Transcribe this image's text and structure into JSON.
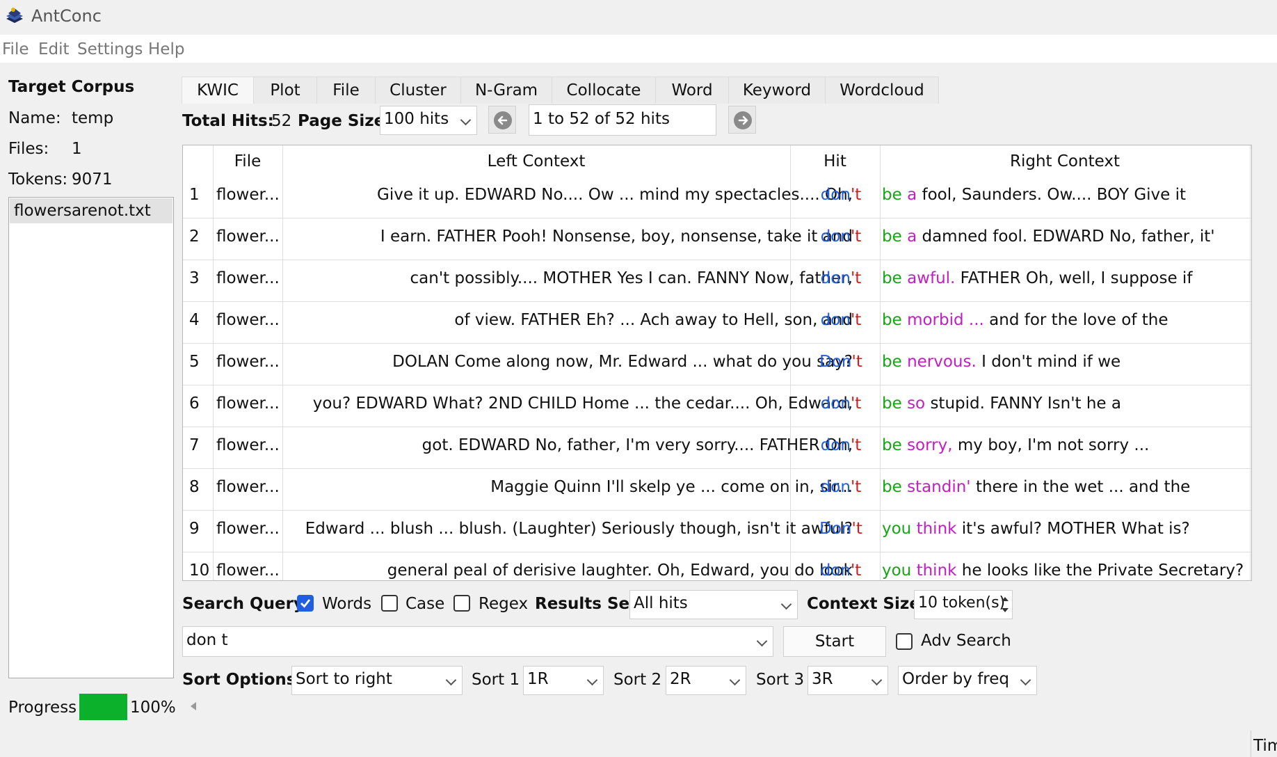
{
  "app": {
    "title": "AntConc"
  },
  "menu": [
    "File",
    "Edit",
    "Settings",
    "Help"
  ],
  "corpus": {
    "heading": "Target Corpus",
    "name_label": "Name:",
    "name_value": "temp",
    "files_label": "Files:",
    "files_value": "1",
    "tokens_label": "Tokens:",
    "tokens_value": "9071",
    "file_list": [
      "flowersarenot.txt"
    ]
  },
  "progress": {
    "label": "Progress",
    "percent_text": "100%",
    "value": 1.0,
    "color": "#0bb02b"
  },
  "tabs": [
    "KWIC",
    "Plot",
    "File",
    "Cluster",
    "N-Gram",
    "Collocate",
    "Word",
    "Keyword",
    "Wordcloud"
  ],
  "active_tab": "KWIC",
  "toolbar": {
    "total_hits_label": "Total Hits:",
    "total_hits_value": "52",
    "page_size_label": "Page Size",
    "page_size_value": "100 hits",
    "range_text": "1 to 52 of 52 hits"
  },
  "table": {
    "headers": [
      "File",
      "Left Context",
      "Hit",
      "Right Context"
    ],
    "rows": [
      {
        "n": "1",
        "file": "flower...",
        "left": "Give it up. EDWARD No.... Ow ... mind my spectacles.... Oh,",
        "hit": "don't",
        "r1": "be",
        "r2": "a",
        "rest": "fool, Saunders. Ow.... BOY Give it"
      },
      {
        "n": "2",
        "file": "flower...",
        "left": "I earn. FATHER Pooh! Nonsense, boy, nonsense, take it and",
        "hit": "don't",
        "r1": "be",
        "r2": "a",
        "rest": "damned fool. EDWARD No, father, it'"
      },
      {
        "n": "3",
        "file": "flower...",
        "left": "can't possibly.... MOTHER Yes I can. FANNY Now, father,",
        "hit": "don't",
        "r1": "be",
        "r2": "awful.",
        "rest": "FATHER Oh, well, I suppose if"
      },
      {
        "n": "4",
        "file": "flower...",
        "left": "of view. FATHER Eh? ... Ach away to Hell, son, and",
        "hit": "don't",
        "r1": "be",
        "r2": "morbid ...",
        "rest": "and for the love of the"
      },
      {
        "n": "5",
        "file": "flower...",
        "left": "DOLAN Come along now, Mr. Edward ... what do you say?",
        "hit": "Don't",
        "r1": "be",
        "r2": "nervous.",
        "rest": "I don't mind if we"
      },
      {
        "n": "6",
        "file": "flower...",
        "left": "you? EDWARD What? 2ND CHILD Home ... the cedar.... Oh, Edward,",
        "hit": "don't",
        "r1": "be",
        "r2": "so",
        "rest": "stupid. FANNY Isn't he a"
      },
      {
        "n": "7",
        "file": "flower...",
        "left": "got. EDWARD No, father, I'm very sorry.... FATHER Oh,",
        "hit": "don't",
        "r1": "be",
        "r2": "sorry,",
        "rest": "my boy, I'm not sorry ..."
      },
      {
        "n": "8",
        "file": "flower...",
        "left": "Maggie Quinn I'll skelp ye ... come on in, sir...",
        "hit": "don't",
        "r1": "be",
        "r2": "standin'",
        "rest": "there in the wet ... and the"
      },
      {
        "n": "9",
        "file": "flower...",
        "left": "Edward ... blush ... blush. (Laughter) Seriously though, isn't it awful?",
        "hit": "Don't",
        "r1": "you",
        "r2": "think",
        "rest": "it's awful? MOTHER What is?"
      },
      {
        "n": "10",
        "file": "flower...",
        "left": "general peal of derisive laughter. Oh, Edward, you do look",
        "hit": "don't",
        "r1": "you",
        "r2": "think",
        "rest": "he looks like the Private Secretary?"
      }
    ]
  },
  "search": {
    "query_label": "Search Query",
    "words_label": "Words",
    "words_checked": true,
    "case_label": "Case",
    "case_checked": false,
    "regex_label": "Regex",
    "regex_checked": false,
    "results_set_label": "Results Set",
    "results_set_value": "All hits",
    "context_size_label": "Context Size",
    "context_size_value": "10 token(s)",
    "query_value": "don t",
    "start_label": "Start",
    "adv_label": "Adv Search",
    "adv_checked": false
  },
  "sort": {
    "label": "Sort Options",
    "mode": "Sort to right",
    "sort1_label": "Sort 1",
    "sort1_value": "1R",
    "sort2_label": "Sort 2",
    "sort2_value": "2R",
    "sort3_label": "Sort 3",
    "sort3_value": "3R",
    "order_value": "Order by freq"
  },
  "status": {
    "text": "Tim"
  },
  "colors": {
    "hit_blue": "#1f5fe0",
    "hit_red": "#e01616",
    "sort1_green": "#16a516",
    "sort2_magenta": "#c21ec2",
    "accent": "#1f5fe0"
  }
}
